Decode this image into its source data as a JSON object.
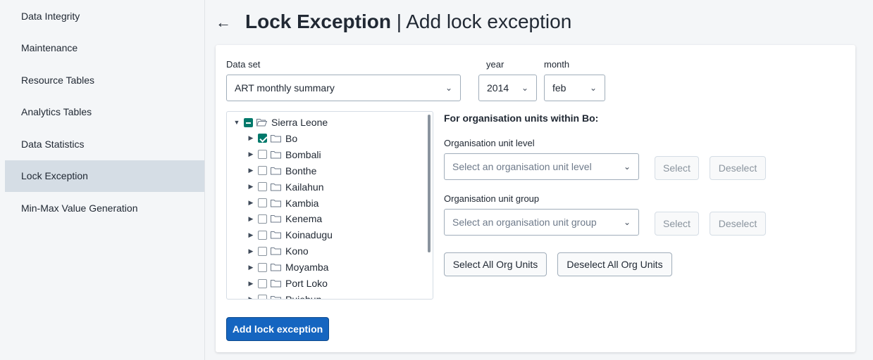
{
  "sidebar": {
    "items": [
      {
        "label": "Data Integrity"
      },
      {
        "label": "Maintenance"
      },
      {
        "label": "Resource Tables"
      },
      {
        "label": "Analytics Tables"
      },
      {
        "label": "Data Statistics"
      },
      {
        "label": "Lock Exception",
        "active": true
      },
      {
        "label": "Min-Max Value Generation"
      }
    ]
  },
  "header": {
    "back_icon": "arrow-left-icon",
    "title_strong": "Lock Exception",
    "title_separator": " | ",
    "title_rest": "Add lock exception"
  },
  "form": {
    "dataset_label": "Data set",
    "dataset_value": "ART monthly summary",
    "year_label": "year",
    "year_value": "2014",
    "month_label": "month",
    "month_value": "feb"
  },
  "tree": {
    "root": "Sierra Leone",
    "children": [
      "Bo",
      "Bombali",
      "Bonthe",
      "Kailahun",
      "Kambia",
      "Kenema",
      "Koinadugu",
      "Kono",
      "Moyamba",
      "Port Loko",
      "Pujehun"
    ],
    "checked": [
      "Bo"
    ]
  },
  "orgunits": {
    "section_title": "For organisation units within Bo:",
    "level_label": "Organisation unit level",
    "level_placeholder": "Select an organisation unit level",
    "group_label": "Organisation unit group",
    "group_placeholder": "Select an organisation unit group",
    "select_label": "Select",
    "deselect_label": "Deselect",
    "select_all_label": "Select All Org Units",
    "deselect_all_label": "Deselect All Org Units"
  },
  "actions": {
    "add_label": "Add lock exception"
  },
  "colors": {
    "primary": "#1565c0",
    "checkbox": "#00796b",
    "active_nav": "#d5dde5"
  }
}
